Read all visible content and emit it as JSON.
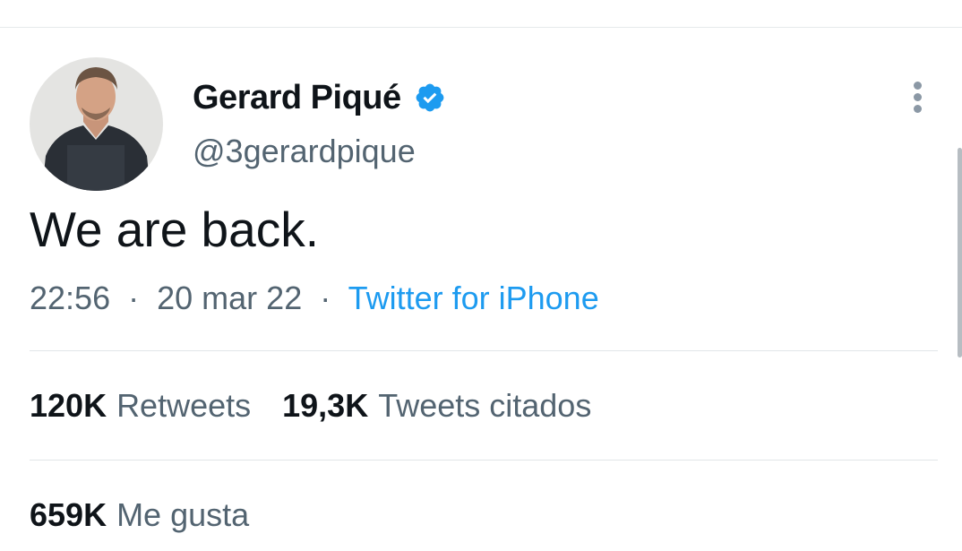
{
  "tweet": {
    "author": {
      "display_name": "Gerard Piqué",
      "handle": "@3gerardpique",
      "verified": true,
      "verified_icon": "verified-badge-icon",
      "avatar_icon": "profile-photo"
    },
    "text": "We are back.",
    "time": "22:56",
    "separator": "·",
    "date": "20 mar 22",
    "source": "Twitter for iPhone",
    "more_icon": "more-vertical-icon",
    "stats": {
      "retweets": {
        "count": "120K",
        "label": "Retweets"
      },
      "quotes": {
        "count": "19,3K",
        "label": "Tweets citados"
      },
      "likes": {
        "count": "659K",
        "label": "Me gusta"
      }
    }
  },
  "colors": {
    "text_primary": "#0f1419",
    "text_secondary": "#536471",
    "link": "#1d9bf0",
    "verified": "#1d9bf0",
    "divider": "#e1e5e8"
  }
}
